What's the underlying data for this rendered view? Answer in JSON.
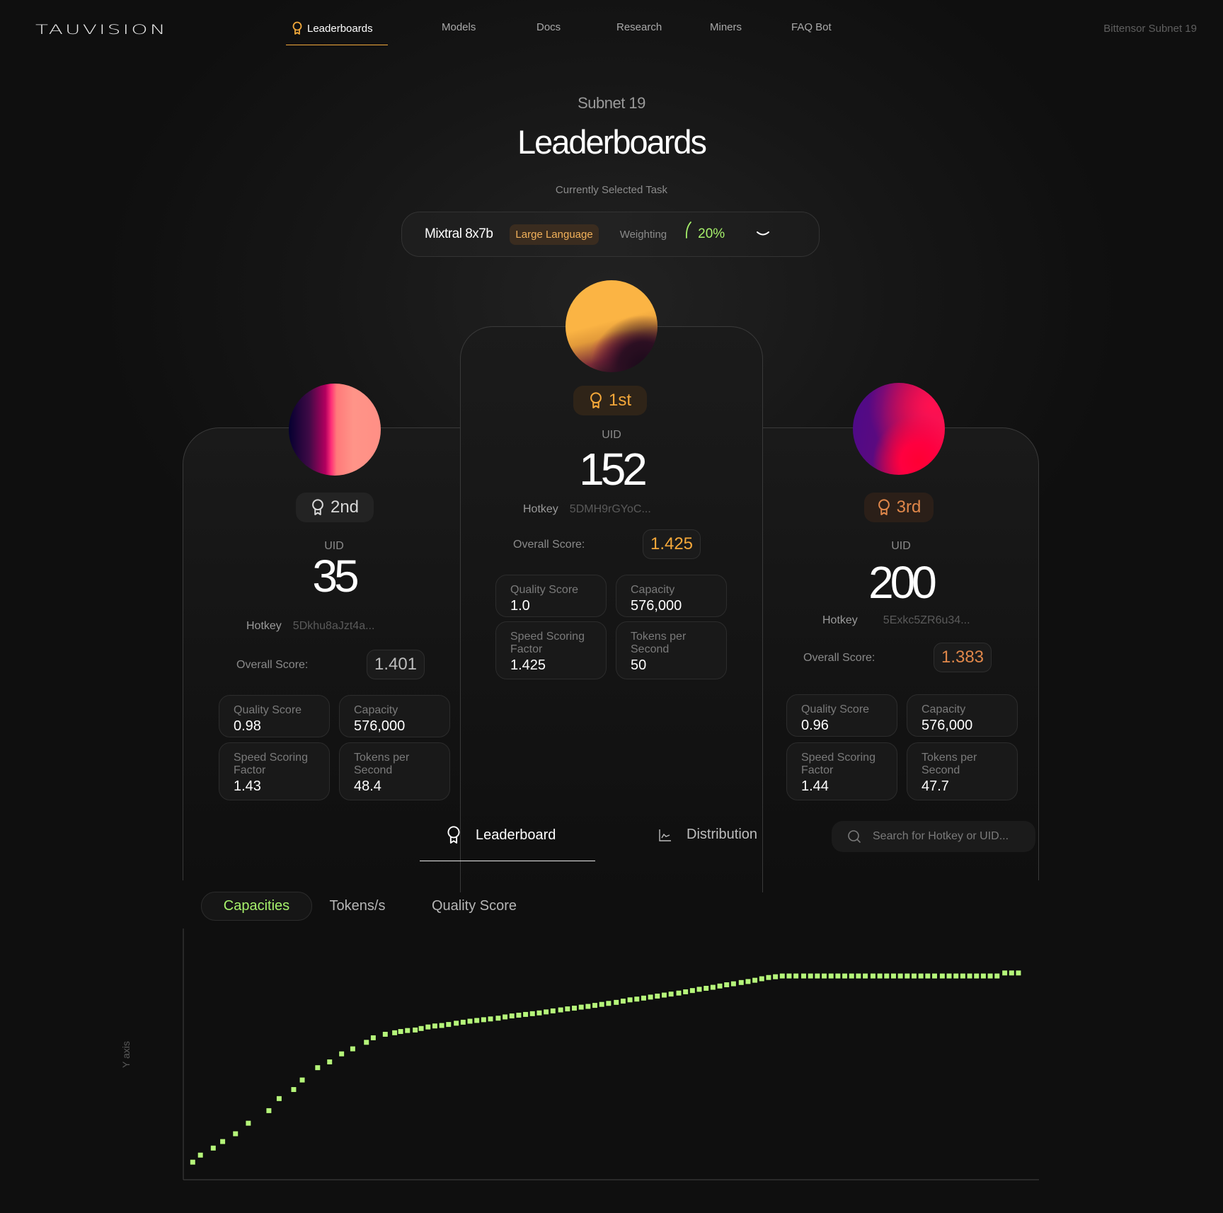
{
  "nav": {
    "logo": "TAUVISION",
    "items": [
      {
        "label": "Leaderboards",
        "icon": "award-icon",
        "active": true
      },
      {
        "label": "Models"
      },
      {
        "label": "Docs"
      },
      {
        "label": "Research"
      },
      {
        "label": "Miners"
      },
      {
        "label": "FAQ Bot"
      }
    ],
    "brand_right": "Bittensor Subnet 19",
    "accent_color": "#f2a93b"
  },
  "header": {
    "subtitle": "Subnet 19",
    "title": "Leaderboards",
    "task_label": "Currently Selected Task"
  },
  "task": {
    "name": "Mixtral 8x7b",
    "tag": "Large Language",
    "weighting_label": "Weighting",
    "weighting_value": "20%",
    "weighting_fraction": 0.2,
    "dropdown_icon": "chevron-down-icon"
  },
  "podium": {
    "first": {
      "rank": "1st",
      "uid_label": "UID",
      "uid": "152",
      "hotkey_label": "Hotkey",
      "hotkey": "5DMH9rGYoC...",
      "score_label": "Overall Score:",
      "score": "1.425",
      "color": "#f5a83a",
      "stats": [
        {
          "label": "Quality Score",
          "value": "1.0"
        },
        {
          "label": "Capacity",
          "value": "576,000"
        },
        {
          "label": "Speed Scoring Factor",
          "value": "1.425"
        },
        {
          "label": "Tokens per Second",
          "value": "50"
        }
      ]
    },
    "second": {
      "rank": "2nd",
      "uid_label": "UID",
      "uid": "35",
      "hotkey_label": "Hotkey",
      "hotkey": "5Dkhu8aJzt4a...",
      "score_label": "Overall Score:",
      "score": "1.401",
      "color": "#d8d8d8",
      "stats": [
        {
          "label": "Quality Score",
          "value": "0.98"
        },
        {
          "label": "Capacity",
          "value": "576,000"
        },
        {
          "label": "Speed Scoring Factor",
          "value": "1.43"
        },
        {
          "label": "Tokens per Second",
          "value": "48.4"
        }
      ]
    },
    "third": {
      "rank": "3rd",
      "uid_label": "UID",
      "uid": "200",
      "hotkey_label": "Hotkey",
      "hotkey": "5Exkc5ZR6u34...",
      "score_label": "Overall Score:",
      "score": "1.383",
      "color": "#e0874a",
      "stats": [
        {
          "label": "Quality Score",
          "value": "0.96"
        },
        {
          "label": "Capacity",
          "value": "576,000"
        },
        {
          "label": "Speed Scoring Factor",
          "value": "1.44"
        },
        {
          "label": "Tokens per Second",
          "value": "47.7"
        }
      ]
    }
  },
  "tabs": {
    "leaderboard": "Leaderboard",
    "distribution": "Distribution",
    "active": "leaderboard",
    "search_placeholder": "Search for Hotkey or UID..."
  },
  "subtabs": {
    "items": [
      "Capacities",
      "Tokens/s",
      "Quality Score"
    ],
    "active": "Capacities",
    "active_color": "#a6f06b"
  },
  "chart_data": {
    "type": "scatter",
    "title": "",
    "xlabel": "",
    "ylabel": "Y axis",
    "grid": false,
    "legend": "none",
    "marker": "square",
    "color": "#b5f57a",
    "ylim": [
      0,
      100
    ],
    "xlim": [
      0,
      100
    ],
    "x": [
      1.1,
      2.0,
      3.5,
      4.6,
      6.1,
      7.6,
      10.0,
      11.2,
      12.9,
      13.9,
      15.7,
      17.1,
      18.5,
      19.8,
      21.4,
      22.2,
      23.6,
      24.7,
      25.4,
      26.2,
      27.1,
      27.8,
      28.6,
      29.4,
      30.2,
      31.0,
      31.9,
      32.7,
      33.5,
      34.3,
      35.1,
      35.9,
      36.8,
      37.6,
      38.4,
      39.2,
      40.0,
      40.8,
      41.6,
      42.4,
      43.2,
      44.1,
      44.9,
      45.7,
      46.5,
      47.3,
      48.1,
      48.9,
      49.7,
      50.6,
      51.4,
      52.2,
      53.0,
      53.8,
      54.6,
      55.4,
      56.2,
      57.0,
      57.9,
      58.7,
      59.5,
      60.3,
      61.1,
      61.9,
      62.7,
      63.5,
      64.3,
      65.2,
      66.0,
      66.8,
      67.6,
      68.4,
      69.2,
      70.0,
      70.8,
      71.6,
      72.5,
      73.3,
      74.1,
      74.9,
      75.7,
      76.5,
      77.3,
      78.1,
      78.9,
      79.7,
      80.6,
      81.4,
      82.2,
      83.0,
      83.8,
      84.6,
      85.4,
      86.2,
      87.0,
      87.8,
      88.7,
      89.5,
      90.3,
      91.1,
      91.9,
      92.7,
      93.5,
      94.3,
      95.1,
      96.0,
      96.8,
      97.6
    ],
    "y": [
      7.0,
      9.8,
      12.6,
      15.2,
      18.3,
      22.5,
      27.5,
      32.3,
      35.9,
      39.7,
      44.6,
      46.9,
      50.1,
      52.1,
      54.7,
      56.5,
      57.9,
      58.5,
      59.0,
      59.4,
      59.6,
      60.2,
      60.8,
      61.2,
      61.4,
      61.8,
      62.3,
      62.7,
      63.1,
      63.4,
      63.7,
      64.0,
      64.3,
      64.8,
      65.2,
      65.5,
      65.8,
      66.1,
      66.4,
      66.8,
      67.2,
      67.6,
      68.0,
      68.3,
      68.7,
      69.0,
      69.4,
      69.8,
      70.2,
      70.6,
      71.1,
      71.6,
      71.9,
      72.3,
      72.7,
      73.1,
      73.5,
      73.9,
      74.3,
      74.8,
      75.3,
      75.8,
      76.2,
      76.6,
      77.1,
      77.6,
      78.0,
      78.5,
      78.9,
      79.4,
      80.0,
      80.5,
      80.8,
      81.1,
      81.1,
      81.1,
      81.1,
      81.1,
      81.1,
      81.1,
      81.1,
      81.1,
      81.1,
      81.1,
      81.1,
      81.1,
      81.1,
      81.1,
      81.1,
      81.1,
      81.1,
      81.1,
      81.1,
      81.1,
      81.1,
      81.1,
      81.1,
      81.1,
      81.1,
      81.1,
      81.1,
      81.1,
      81.1,
      81.1,
      81.1,
      82.3,
      82.3,
      82.3,
      82.3,
      82.3
    ]
  }
}
